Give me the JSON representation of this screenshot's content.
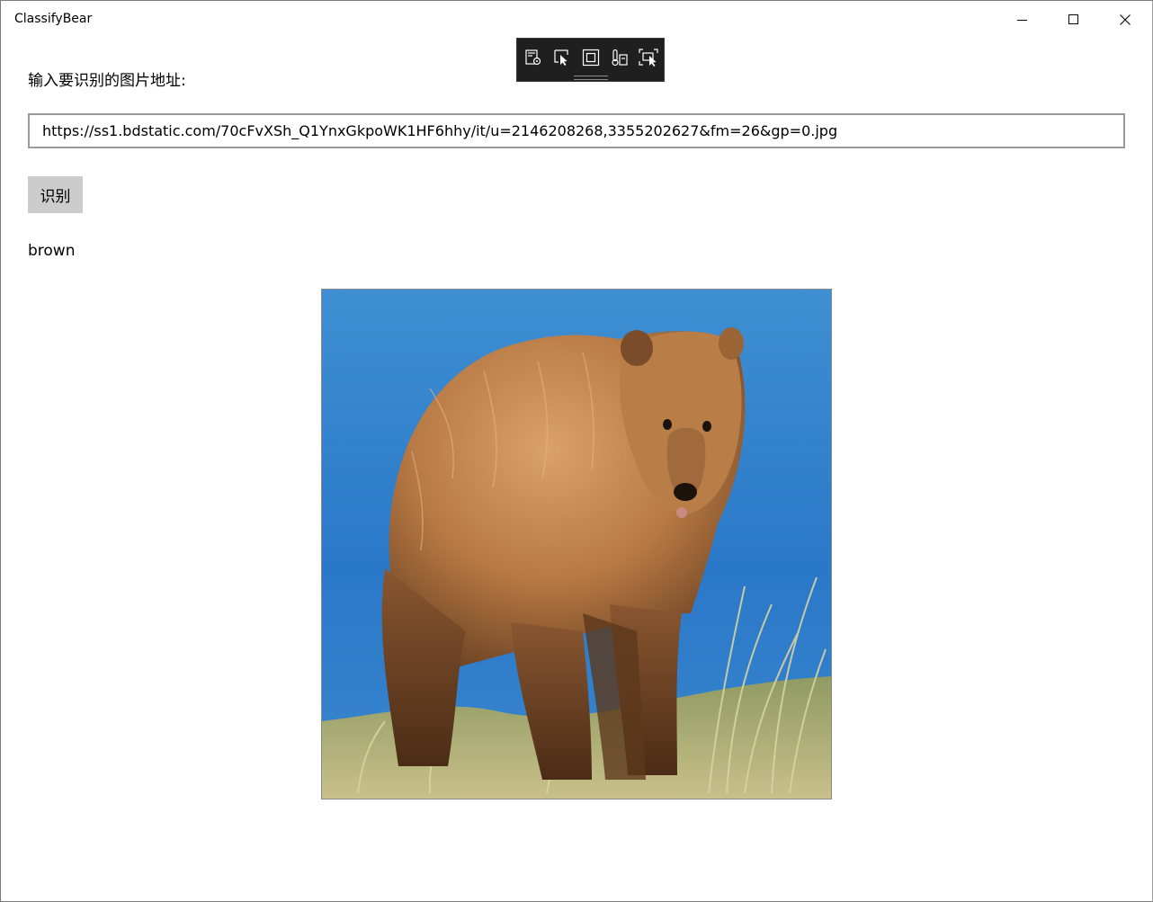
{
  "window": {
    "title": "ClassifyBear",
    "controls": [
      "minimize-icon",
      "maximize-icon",
      "close-icon"
    ]
  },
  "debug_toolbar": {
    "tools": [
      "live-visual-tree-icon",
      "select-element-icon",
      "display-layout-adorners-icon",
      "track-focus-icon",
      "preview-selection-icon"
    ]
  },
  "form": {
    "prompt_label": "输入要识别的图片地址:",
    "url_value": "https://ss1.bdstatic.com/70cFvXSh_Q1YnxGkpoWK1HF6hhy/it/u=2146208268,3355202627&fm=26&gp=0.jpg",
    "recognize_button": "识别"
  },
  "result": {
    "label": "brown"
  },
  "image": {
    "subject": "brown bear standing on grass by blue water"
  }
}
